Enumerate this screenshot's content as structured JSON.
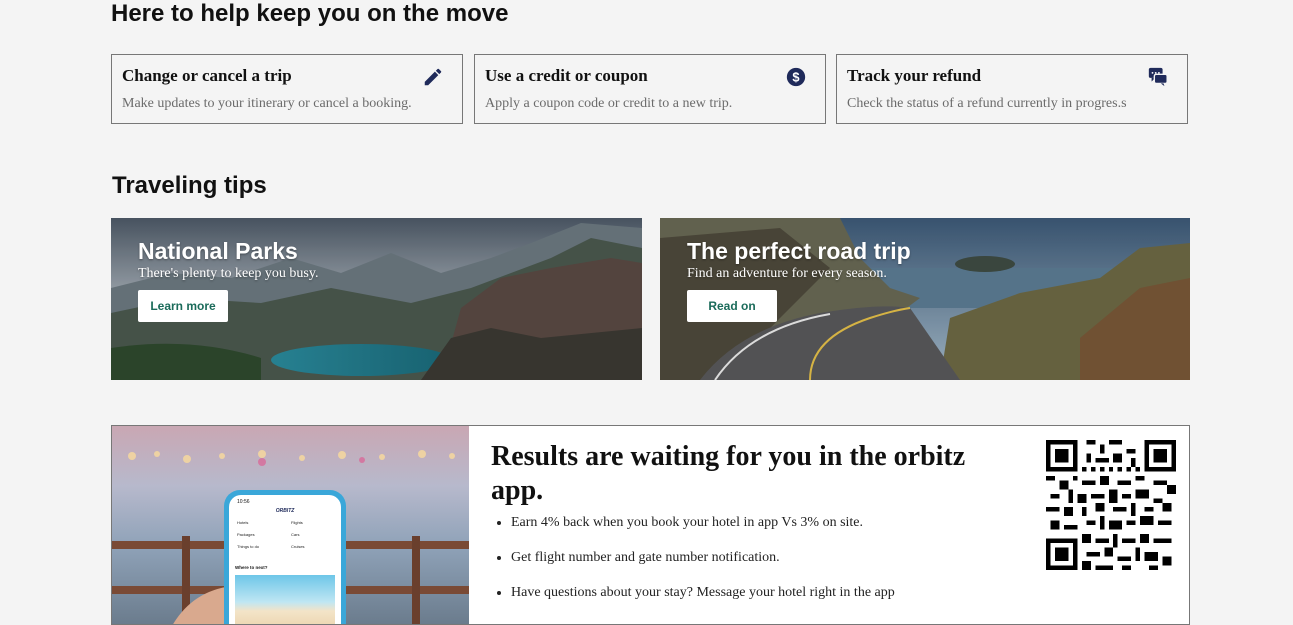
{
  "help": {
    "heading": "Here to help keep you on the move",
    "cards": [
      {
        "title": "Change or cancel a trip",
        "desc": "Make updates to your itinerary or cancel a booking.",
        "icon": "pencil-icon"
      },
      {
        "title": "Use a credit or coupon",
        "desc": "Apply a coupon code or credit to a new trip.",
        "icon": "dollar-coin-icon"
      },
      {
        "title": "Track your refund",
        "desc": "Check the status of a refund currently in progres.s",
        "icon": "chat-bubbles-icon"
      }
    ]
  },
  "tips": {
    "heading": "Traveling tips",
    "items": [
      {
        "title": "National Parks",
        "subtitle": "There's plenty to keep you busy.",
        "button": "Learn more"
      },
      {
        "title": "The perfect road trip",
        "subtitle": "Find an adventure for every season.",
        "button": "Read on"
      }
    ]
  },
  "promo": {
    "title": "Results are waiting for you in the orbitz app.",
    "bullets": [
      "Earn 4% back when you book your hotel in app Vs 3% on site.",
      "Get flight number and gate number notification.",
      "Have questions about your stay? Message your hotel right in the app"
    ],
    "phone": {
      "time": "10:56",
      "brand": "ORBITZ",
      "menu": [
        "Hotels",
        "Flights",
        "Packages",
        "Cars",
        "Things to do",
        "Cruises"
      ],
      "search": "Where to next?"
    }
  },
  "colors": {
    "icon": "#1f2a5a",
    "button_text": "#1b6b5a",
    "background": "#f4f4f4"
  }
}
